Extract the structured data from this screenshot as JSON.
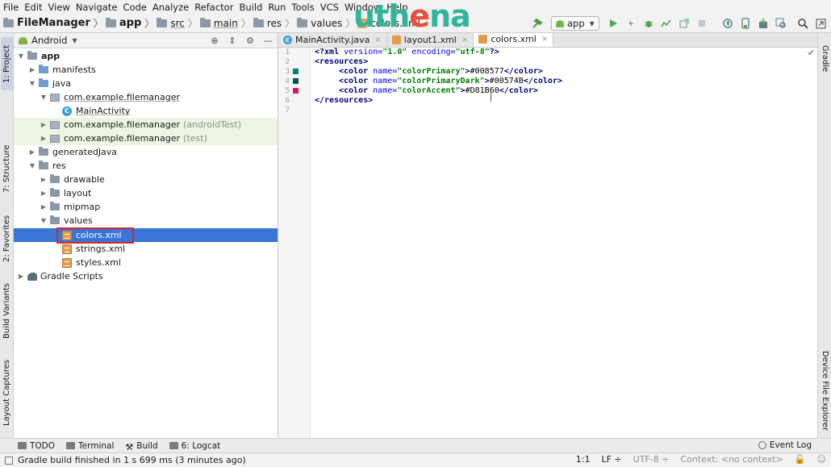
{
  "menu": [
    "File",
    "Edit",
    "View",
    "Navigate",
    "Code",
    "Analyze",
    "Refactor",
    "Build",
    "Run",
    "Tools",
    "VCS",
    "Window",
    "Help"
  ],
  "breadcrumb": {
    "project": "FileManager",
    "items": [
      "app",
      "src",
      "main",
      "res",
      "values"
    ],
    "file": "colors.xml"
  },
  "logo": {
    "part1": "uth",
    "part2": "e",
    "part3": "na"
  },
  "toolbar": {
    "run_config": "app",
    "icons": [
      "hammer-icon",
      "run-icon",
      "apply-changes-icon",
      "debug-icon",
      "profile-icon",
      "attach-icon",
      "stop-icon",
      "sync-icon",
      "avd-icon",
      "sdk-icon",
      "layout-inspector-icon",
      "search-icon",
      "ide-updates-icon"
    ]
  },
  "left_strip": {
    "project_tab": "1: Project",
    "structure_tab": "7: Structure",
    "favorites_tab": "2: Favorites",
    "build_variants_tab": "Build Variants",
    "captures_tab": "Layout Captures"
  },
  "right_strip": {
    "gradle_tab": "Gradle",
    "device_explorer_tab": "Device File Explorer"
  },
  "project_panel": {
    "view_mode": "Android",
    "tree": [
      {
        "label": "app",
        "hint": ""
      },
      {
        "label": "manifests",
        "hint": ""
      },
      {
        "label": "java",
        "hint": ""
      },
      {
        "label": "com.example.filemanager",
        "hint": ""
      },
      {
        "label": "MainActivity",
        "hint": ""
      },
      {
        "label": "com.example.filemanager",
        "hint": "(androidTest)"
      },
      {
        "label": "com.example.filemanager",
        "hint": "(test)"
      },
      {
        "label": "generatedJava",
        "hint": ""
      },
      {
        "label": "res",
        "hint": ""
      },
      {
        "label": "drawable",
        "hint": ""
      },
      {
        "label": "layout",
        "hint": ""
      },
      {
        "label": "mipmap",
        "hint": ""
      },
      {
        "label": "values",
        "hint": ""
      },
      {
        "label": "colors.xml",
        "hint": ""
      },
      {
        "label": "strings.xml",
        "hint": ""
      },
      {
        "label": "styles.xml",
        "hint": ""
      },
      {
        "label": "Gradle Scripts",
        "hint": ""
      }
    ]
  },
  "editor": {
    "tabs": [
      {
        "label": "MainActivity.java",
        "active": false
      },
      {
        "label": "layout1.xml",
        "active": false
      },
      {
        "label": "colors.xml",
        "active": true
      }
    ],
    "line_numbers": [
      "1",
      "2",
      "3",
      "4",
      "5",
      "6",
      "7"
    ],
    "swatch_colors": [
      "#008577",
      "#00574B",
      "#D81B60"
    ],
    "code": {
      "l1_open": "<?xml ",
      "l1_attr1": "version=",
      "l1_val1": "\"1.0\"",
      "l1_attr2": " encoding=",
      "l1_val2": "\"utf-8\"",
      "l1_close": "?>",
      "l2": "<resources>",
      "colors": [
        {
          "open": "<color ",
          "attr": "name=",
          "name": "\"colorPrimary\"",
          "gt": ">",
          "value": "#008577",
          "close": "</color>"
        },
        {
          "open": "<color ",
          "attr": "name=",
          "name": "\"colorPrimaryDark\"",
          "gt": ">",
          "value": "#00574B",
          "close": "</color>"
        },
        {
          "open": "<color ",
          "attr": "name=",
          "name": "\"colorAccent\"",
          "gt": ">",
          "value": "#D81B60",
          "close": "</color>"
        }
      ],
      "l6": "</resources>"
    }
  },
  "bottom_tabs": {
    "todo": "TODO",
    "terminal": "Terminal",
    "build": "Build",
    "logcat": "6: Logcat",
    "event_log": "Event Log"
  },
  "status": {
    "message": "Gradle build finished in 1 s 699 ms (3 minutes ago)",
    "position": "1:1",
    "line_sep": "LF ÷",
    "encoding": "UTF-8 ÷",
    "context": "Context: <no context>"
  }
}
